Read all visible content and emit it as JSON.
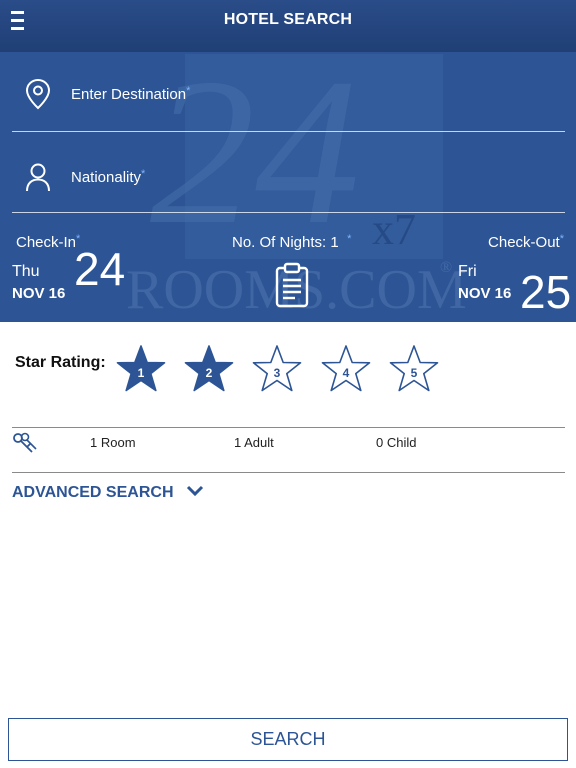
{
  "header": {
    "title": "HOTEL SEARCH",
    "menu_icon": "hamburger-menu-icon"
  },
  "watermark": {
    "text": "ROOMS.COM",
    "marks": [
      "24",
      "x7",
      "®"
    ]
  },
  "destination": {
    "label": "Enter Destination",
    "required_mark": "*",
    "icon": "location-pin-icon"
  },
  "nationality": {
    "label": "Nationality",
    "required_mark": "*",
    "icon": "person-icon"
  },
  "dates": {
    "checkin_label": "Check-In",
    "checkin_day": "Thu",
    "checkin_month": "NOV 16",
    "checkin_date": "24",
    "nights_label": "No. Of Nights: 1",
    "required_mark": "*",
    "checkout_label": "Check-Out",
    "checkout_day": "Fri",
    "checkout_month": "NOV 16",
    "checkout_date": "25",
    "calendar_icon": "calendar-clipboard-icon"
  },
  "stars": {
    "label": "Star Rating:",
    "items": [
      {
        "value": "1",
        "selected": true
      },
      {
        "value": "2",
        "selected": true
      },
      {
        "value": "3",
        "selected": false
      },
      {
        "value": "4",
        "selected": false
      },
      {
        "value": "5",
        "selected": false
      }
    ]
  },
  "occupancy": {
    "rooms": "1 Room",
    "adults": "1 Adult",
    "children": "0 Child",
    "icon": "keys-icon"
  },
  "advanced_search": {
    "label": "ADVANCED SEARCH",
    "icon": "chevron-down-icon"
  },
  "search_button": {
    "label": "SEARCH"
  },
  "colors": {
    "primary": "#2d5595",
    "header": "#1f3f76",
    "required": "#7fb4ff",
    "text_dark": "#111111"
  }
}
